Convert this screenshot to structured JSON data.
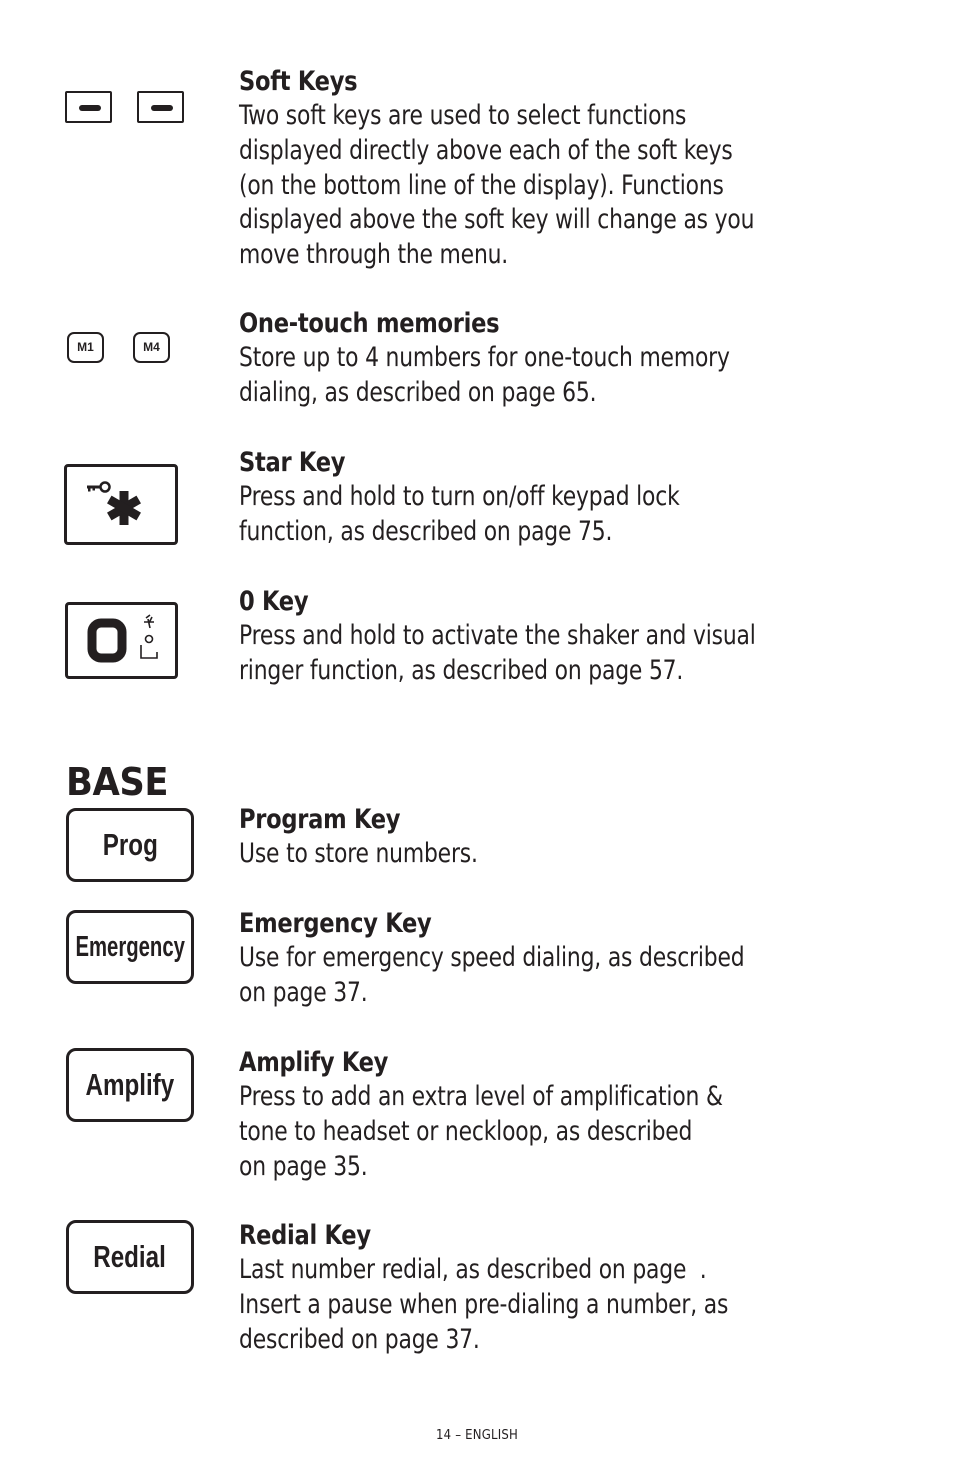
{
  "handset_entries": [
    {
      "title": "Soft Keys",
      "lines": [
        "Two soft keys are used to select functions",
        "displayed directly above each of the soft keys",
        "(on the bottom line of the display). Functions",
        "displayed above the soft key will change as you",
        "move through the menu."
      ],
      "icon": "soft-keys-icon"
    },
    {
      "title": "One-touch memories",
      "lines": [
        "Store up to 4 numbers for one-touch memory",
        "dialing, as described on page 65."
      ],
      "icon": "memory-keys-icon",
      "key_labels": [
        "M1",
        "M4"
      ]
    },
    {
      "title": "Star Key",
      "lines": [
        "Press and hold to turn on/off keypad lock",
        "function, as described on page 75."
      ],
      "icon": "star-key-lock-icon"
    },
    {
      "title": "0 Key",
      "lines": [
        "Press and hold to activate the shaker and visual",
        "ringer function, as described on page 57."
      ],
      "icon": "zero-key-shaker-icon"
    }
  ],
  "base_section": {
    "heading": "BASE",
    "entries": [
      {
        "title": "Program Key",
        "key_label": "Prog",
        "lines": [
          "Use to store numbers."
        ],
        "icon": "prog-key-icon"
      },
      {
        "title": "Emergency Key",
        "key_label": "Emergency",
        "lines": [
          "Use for emergency speed dialing, as described",
          "on page 37."
        ],
        "icon": "emergency-key-icon"
      },
      {
        "title": "Amplify Key",
        "key_label": "Amplify",
        "lines": [
          "Press to add an extra level of amplification &",
          "tone to headset or neckloop, as described",
          "on page 35."
        ],
        "icon": "amplify-key-icon"
      },
      {
        "title": "Redial Key",
        "key_label": "Redial",
        "lines": [
          "Last number redial, as described on page  .",
          "Insert a pause when pre-dialing a number, as",
          "described on page 37."
        ],
        "icon": "redial-key-icon"
      }
    ]
  },
  "footer": {
    "page_label": "14 – ENGLISH"
  }
}
